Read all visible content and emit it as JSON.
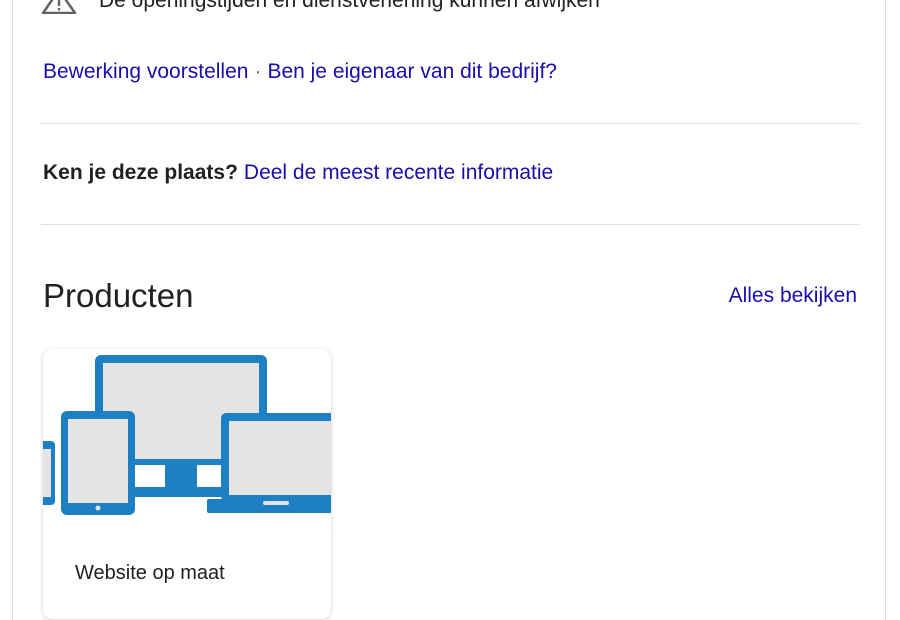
{
  "notice": {
    "icon": "warning-triangle-icon",
    "text": "De openingstijden en dienstverlening kunnen afwijken"
  },
  "edit_links": {
    "suggest_edit": "Bewerking voorstellen",
    "separator": "·",
    "owner": "Ben je eigenaar van dit bedrijf?"
  },
  "know_place": {
    "question": "Ken je deze plaats?",
    "link": "Deel de meest recente informatie"
  },
  "products": {
    "title": "Producten",
    "see_all": "Alles bekijken",
    "items": [
      {
        "name": "Website op maat",
        "image": "responsive-devices-icon"
      }
    ]
  },
  "colors": {
    "link": "#1a0dab",
    "text": "#202124",
    "divider": "#e0e0e0",
    "device_blue": "#1f7fc4",
    "device_screen": "#e4e4e4"
  }
}
